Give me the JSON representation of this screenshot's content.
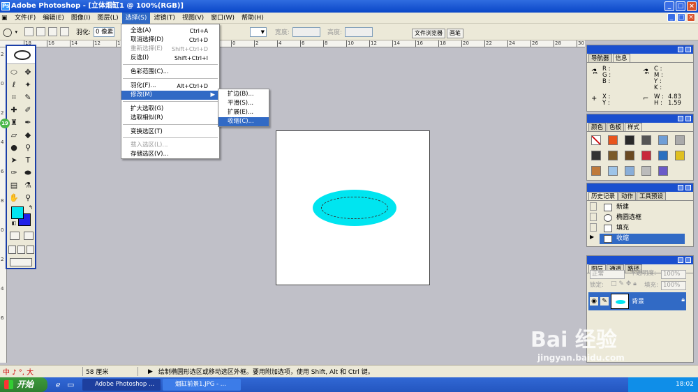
{
  "window": {
    "title": "Adobe Photoshop - [立体烟缸1 @ 100%(RGB)]",
    "minimize": "_",
    "maximize": "□",
    "close": "×"
  },
  "menubar": {
    "items": [
      "文件(F)",
      "编辑(E)",
      "图像(I)",
      "图层(L)",
      "选择(S)",
      "滤镜(T)",
      "视图(V)",
      "窗口(W)",
      "帮助(H)"
    ]
  },
  "optionsbar": {
    "feather_label": "羽化:",
    "feather_value": "0 像素",
    "width_label": "宽度:",
    "height_label": "高度:",
    "file_browser_tab": "文件浏览器",
    "brushes_tab": "画笔"
  },
  "select_menu": {
    "items": [
      {
        "label": "全选(A)",
        "shortcut": "Ctrl+A",
        "disabled": false
      },
      {
        "label": "取消选择(D)",
        "shortcut": "Ctrl+D",
        "disabled": false
      },
      {
        "label": "重新选择(E)",
        "shortcut": "Shift+Ctrl+D",
        "disabled": true
      },
      {
        "label": "反选(I)",
        "shortcut": "Shift+Ctrl+I",
        "disabled": false
      },
      {
        "label": "色彩范围(C)...",
        "shortcut": "",
        "disabled": false
      },
      {
        "label": "羽化(F)...",
        "shortcut": "Alt+Ctrl+D",
        "disabled": false
      },
      {
        "label": "修改(M)",
        "shortcut": "",
        "disabled": false,
        "selected": true,
        "submenu": true
      },
      {
        "label": "扩大选取(G)",
        "shortcut": "",
        "disabled": false
      },
      {
        "label": "选取相似(R)",
        "shortcut": "",
        "disabled": false
      },
      {
        "label": "变换选区(T)",
        "shortcut": "",
        "disabled": false
      },
      {
        "label": "载入选区(L)...",
        "shortcut": "",
        "disabled": true
      },
      {
        "label": "存储选区(V)...",
        "shortcut": "",
        "disabled": false
      }
    ]
  },
  "modify_submenu": {
    "items": [
      {
        "label": "扩边(B)...",
        "selected": false
      },
      {
        "label": "平滑(S)...",
        "selected": false
      },
      {
        "label": "扩展(E)...",
        "selected": false
      },
      {
        "label": "收缩(C)...",
        "selected": true
      }
    ]
  },
  "navigator_panel": {
    "tabs": [
      "导航器",
      "信息"
    ],
    "rgb_labels": "R :\nG :\nB :",
    "cmyk_labels": "C :\nM :\nY :\nK :",
    "xy_labels": "X :\nY :",
    "wh_labels": "W :\nH :",
    "wh_values": "4.83\n1.59"
  },
  "color_panel": {
    "tabs": [
      "颜色",
      "色板",
      "样式"
    ]
  },
  "history_panel": {
    "tabs": [
      "历史记录",
      "动作",
      "工具预设"
    ],
    "items": [
      {
        "label": "新建",
        "selected": false
      },
      {
        "label": "椭圆选框",
        "selected": false
      },
      {
        "label": "填充",
        "selected": false
      },
      {
        "label": "收缩",
        "selected": true
      }
    ]
  },
  "layers_panel": {
    "tabs": [
      "图层",
      "通道",
      "路径"
    ],
    "blend_mode": "正常",
    "opacity_label": "不透明度:",
    "opacity_value": "100%",
    "lock_label": "锁定:",
    "fill_label": "填充:",
    "fill_value": "100%",
    "layer_name": "背景"
  },
  "statusbar": {
    "ime": "中 ♪ °, 大",
    "size": "58 厘米",
    "hint": "绘制椭圆形选区或移动选区外框。要用附加选项，使用 Shift, Alt 和 Ctrl 键。"
  },
  "taskbar": {
    "start": "开始",
    "tasks": [
      "Adobe Photoshop ...",
      "烟缸前景1.JPG - ..."
    ],
    "clock": "18:02"
  },
  "watermark": {
    "brand": "Bai 经验",
    "url": "jingyan.baidu.com"
  },
  "ruler": {
    "h_numbers": [
      "18",
      "16",
      "14",
      "12",
      "10",
      "8",
      "6",
      "4",
      "2",
      "0",
      "2",
      "4",
      "6",
      "8",
      "10",
      "12",
      "14",
      "16",
      "18",
      "20",
      "22",
      "24",
      "26",
      "28",
      "30",
      "32"
    ],
    "v_numbers": [
      "2",
      "0",
      "2",
      "4",
      "6",
      "8",
      "0",
      "2",
      "4",
      "6"
    ]
  },
  "badge": {
    "value": "19"
  },
  "colors": {
    "accent": "#316ac5",
    "foreground": "#00e5f0",
    "background_swatch": "#2020e8",
    "ellipse": "#00e5f0"
  }
}
